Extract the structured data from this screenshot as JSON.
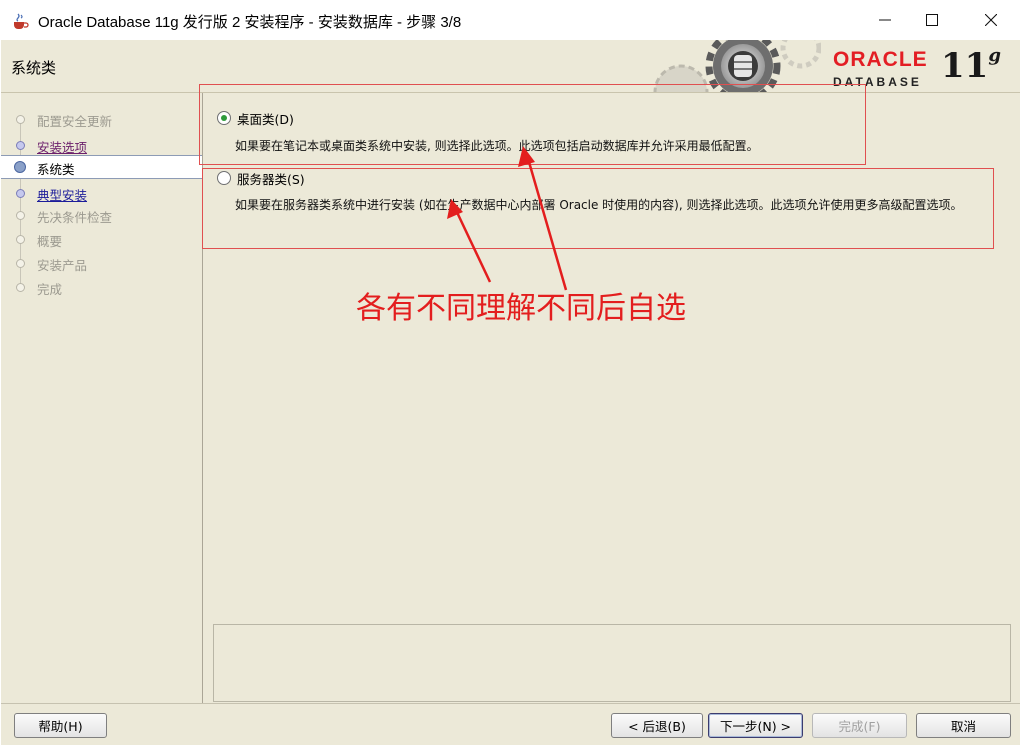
{
  "window": {
    "title": "Oracle Database 11g 发行版 2 安装程序 - 安装数据库 - 步骤 3/8"
  },
  "header": {
    "title": "系统类",
    "logo_oracle": "ORACLE",
    "logo_database": "DATABASE",
    "logo_version": "11",
    "logo_version_suffix": "g"
  },
  "sidebar": {
    "steps": [
      {
        "label": "配置安全更新",
        "state": "disabled"
      },
      {
        "label": "安装选项",
        "state": "visited"
      },
      {
        "label": "系统类",
        "state": "current"
      },
      {
        "label": "典型安装",
        "state": "link"
      },
      {
        "label": "先决条件检查",
        "state": "disabled"
      },
      {
        "label": "概要",
        "state": "disabled"
      },
      {
        "label": "安装产品",
        "state": "disabled"
      },
      {
        "label": "完成",
        "state": "disabled"
      }
    ]
  },
  "options": [
    {
      "label": "桌面类(D)",
      "selected": true,
      "description": "如果要在笔记本或桌面类系统中安装, 则选择此选项。此选项包括启动数据库并允许采用最低配置。"
    },
    {
      "label": "服务器类(S)",
      "selected": false,
      "description": "如果要在服务器类系统中进行安装 (如在生产数据中心内部署 Oracle 时使用的内容), 则选择此选项。此选项允许使用更多高级配置选项。"
    }
  ],
  "annotation": {
    "text": "各有不同理解不同后自选",
    "color": "#e31e1e"
  },
  "footer": {
    "help": "帮助(H)",
    "back": "< 后退(B)",
    "next": "下一步(N) >",
    "finish": "完成(F)",
    "cancel": "取消"
  }
}
